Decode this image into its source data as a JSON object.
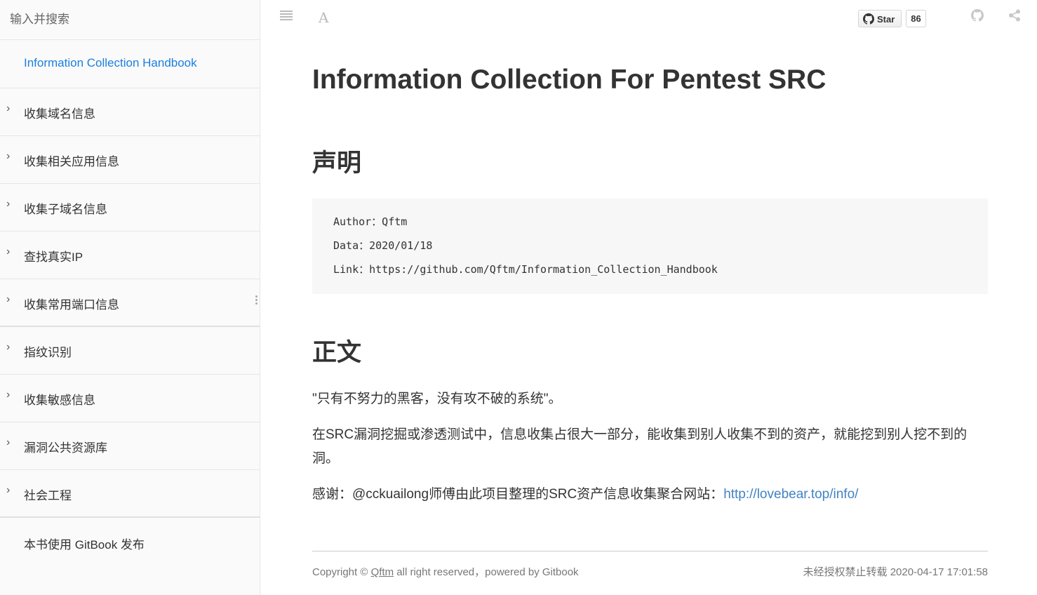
{
  "sidebar": {
    "search_placeholder": "输入并搜索",
    "home": "Information Collection Handbook",
    "items": [
      {
        "label": "收集域名信息"
      },
      {
        "label": "收集相关应用信息"
      },
      {
        "label": "收集子域名信息"
      },
      {
        "label": "查找真实IP"
      },
      {
        "label": "收集常用端口信息"
      },
      {
        "label": "指纹识别"
      },
      {
        "label": "收集敏感信息"
      },
      {
        "label": "漏洞公共资源库"
      },
      {
        "label": "社会工程"
      }
    ],
    "footer": "本书使用 GitBook 发布",
    "chevron": "›"
  },
  "toolbar": {
    "star_label": "Star",
    "star_count": "86",
    "menu_icon": "≣",
    "font_icon": "A"
  },
  "page": {
    "title": "Information Collection For Pentest SRC",
    "section1": "声明",
    "code_lines": [
      "Author：Qftm",
      "Data：2020/01/18",
      "Link：https://github.com/Qftm/Information_Collection_Handbook"
    ],
    "section2": "正文",
    "p1": "\"只有不努力的黑客，没有攻不破的系统\"。",
    "p2": "在SRC漏洞挖掘或渗透测试中，信息收集占很大一部分，能收集到别人收集不到的资产，就能挖到别人挖不到的洞。",
    "p3_text": "感谢：@cckuailong师傅由此项目整理的SRC资产信息收集聚合网站：",
    "p3_link": "http://lovebear.top/info/"
  },
  "footer": {
    "copyright_prefix": "Copyright ©",
    "author": "Qftm",
    "copyright_suffix": "all right reserved，powered by Gitbook",
    "right": "未经授权禁止转载 2020-04-17 17:01:58"
  },
  "colors": {
    "link": "#4183c4",
    "sidebar_active": "#1a7fe0",
    "sidebar_bg": "#fafafa"
  }
}
